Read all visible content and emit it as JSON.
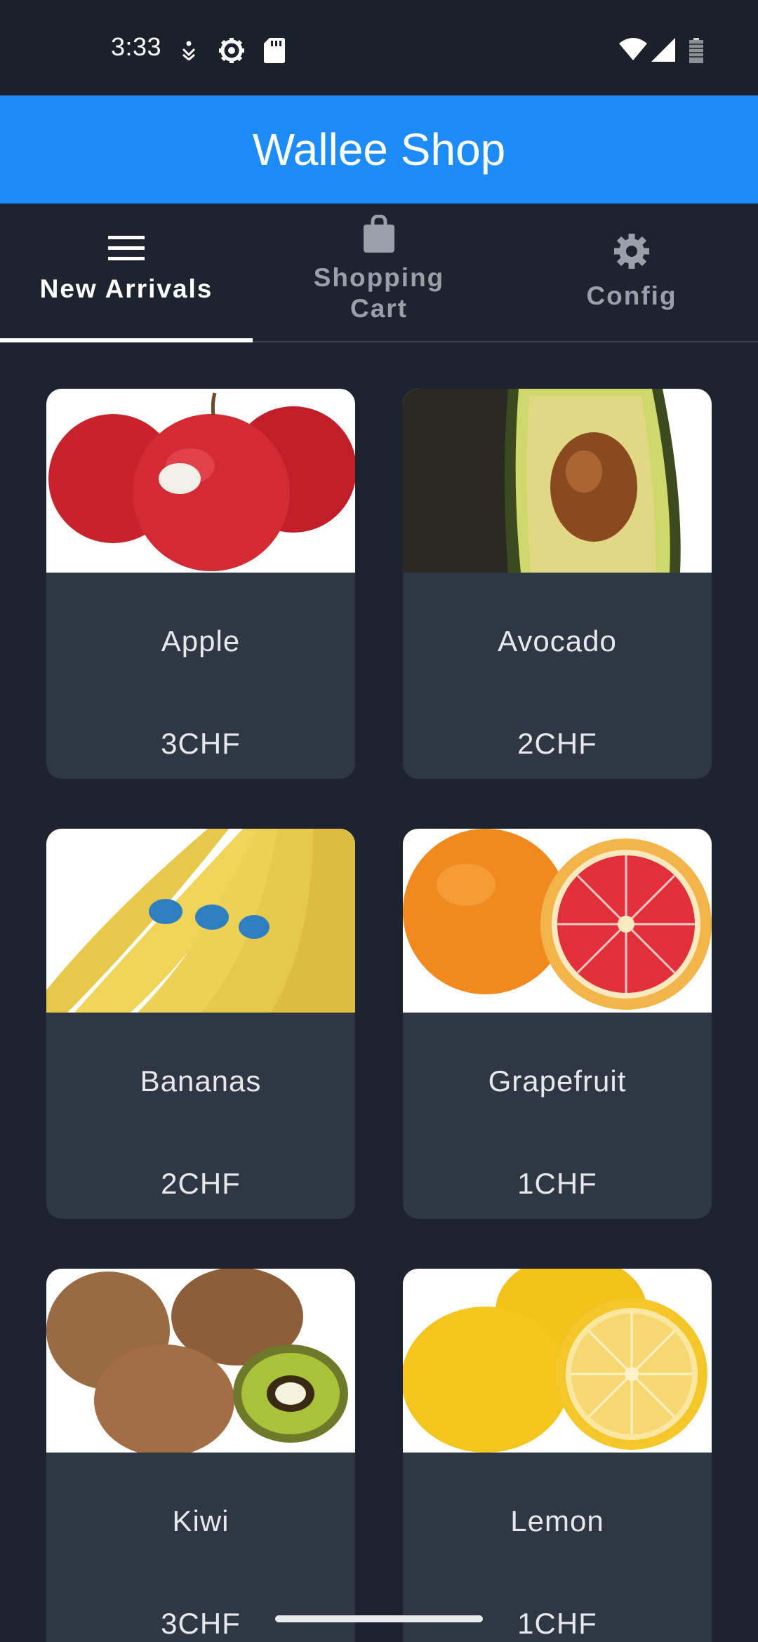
{
  "status_bar": {
    "time": "3:33",
    "icons": [
      "accessibility-icon",
      "settings-gear-icon",
      "sd-card-icon",
      "wifi-icon",
      "cell-signal-icon",
      "battery-icon"
    ]
  },
  "app_bar": {
    "title": "Wallee Shop",
    "color": "#1e8cf8"
  },
  "tabs": [
    {
      "label": "New Arrivals",
      "icon": "menu-icon",
      "active": true
    },
    {
      "label": "Shopping Cart",
      "icon": "shopping-bag-icon",
      "active": false
    },
    {
      "label": "Config",
      "icon": "gear-icon",
      "active": false
    }
  ],
  "products": [
    {
      "name": "Apple",
      "price": "3CHF",
      "image": "apple-image"
    },
    {
      "name": "Avocado",
      "price": "2CHF",
      "image": "avocado-image"
    },
    {
      "name": "Bananas",
      "price": "2CHF",
      "image": "bananas-image"
    },
    {
      "name": "Grapefruit",
      "price": "1CHF",
      "image": "grapefruit-image"
    },
    {
      "name": "Kiwi",
      "price": "3CHF",
      "image": "kiwi-image"
    },
    {
      "name": "Lemon",
      "price": "1CHF",
      "image": "lemon-image"
    }
  ]
}
